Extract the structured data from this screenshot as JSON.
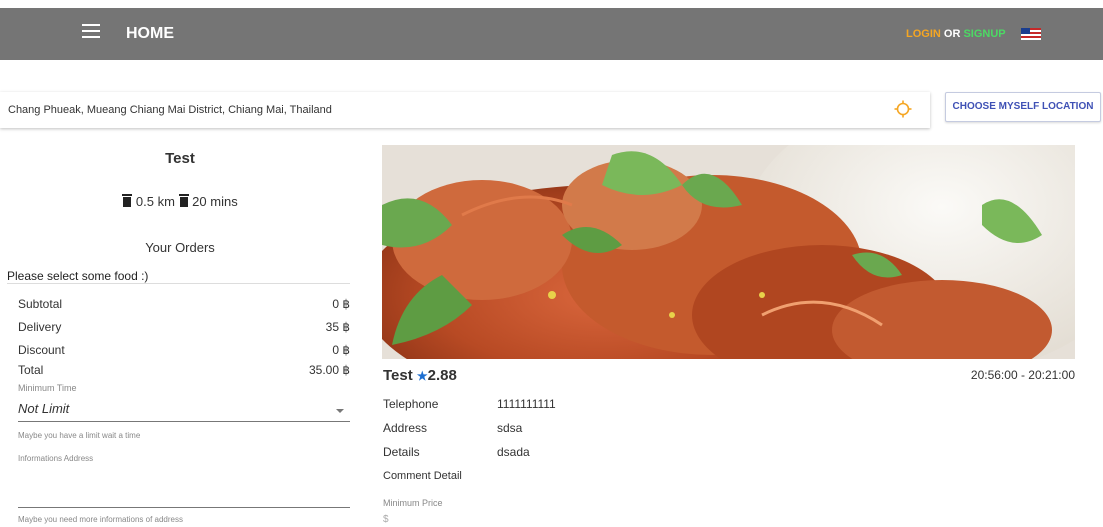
{
  "header": {
    "title": "HOME",
    "login": "LOGIN",
    "or": "OR",
    "signup": "SIGNUP"
  },
  "location": {
    "address": "Chang Phueak, Mueang Chiang Mai District, Chiang Mai, Thailand",
    "choose_button": "CHOOSE MYSELF LOCATION"
  },
  "shop": {
    "name": "Test",
    "distance": "0.5 km",
    "time": "20 mins"
  },
  "orders": {
    "title": "Your Orders",
    "empty_message": "Please select some food :)",
    "subtotal_label": "Subtotal",
    "subtotal_value": "0 ฿",
    "delivery_label": "Delivery",
    "delivery_value": "35 ฿",
    "discount_label": "Discount",
    "discount_value": "0 ฿",
    "total_label": "Total",
    "total_value": "35.00 ฿",
    "min_time_label": "Minimum Time",
    "min_time_value": "Not Limit",
    "min_time_help": "Maybe you have a limit wait a time",
    "info_address_label": "Informations Address",
    "info_address_help": "Maybe you need more informations of address"
  },
  "details": {
    "name": "Test",
    "star": "★",
    "rating": "2.88",
    "hours": "20:56:00 - 20:21:00",
    "telephone_label": "Telephone",
    "telephone_value": "1111111111",
    "address_label": "Address",
    "address_value": "sdsa",
    "details_label": "Details",
    "details_value": "dsada",
    "comment_label": "Comment Detail",
    "min_price_label": "Minimum Price",
    "min_price_value": "$"
  },
  "colors": {
    "header_bg": "#757575",
    "login": "#f5a623",
    "signup": "#4cd964",
    "accent": "#3f51b5",
    "target_icon": "#f5a623",
    "star": "#1e6fd1"
  },
  "icons": {
    "menu": "hamburger-icon",
    "flag": "us-flag-icon",
    "target": "crosshair-icon",
    "distance": "trash-icon",
    "time": "trash-icon",
    "rating": "star-icon"
  }
}
